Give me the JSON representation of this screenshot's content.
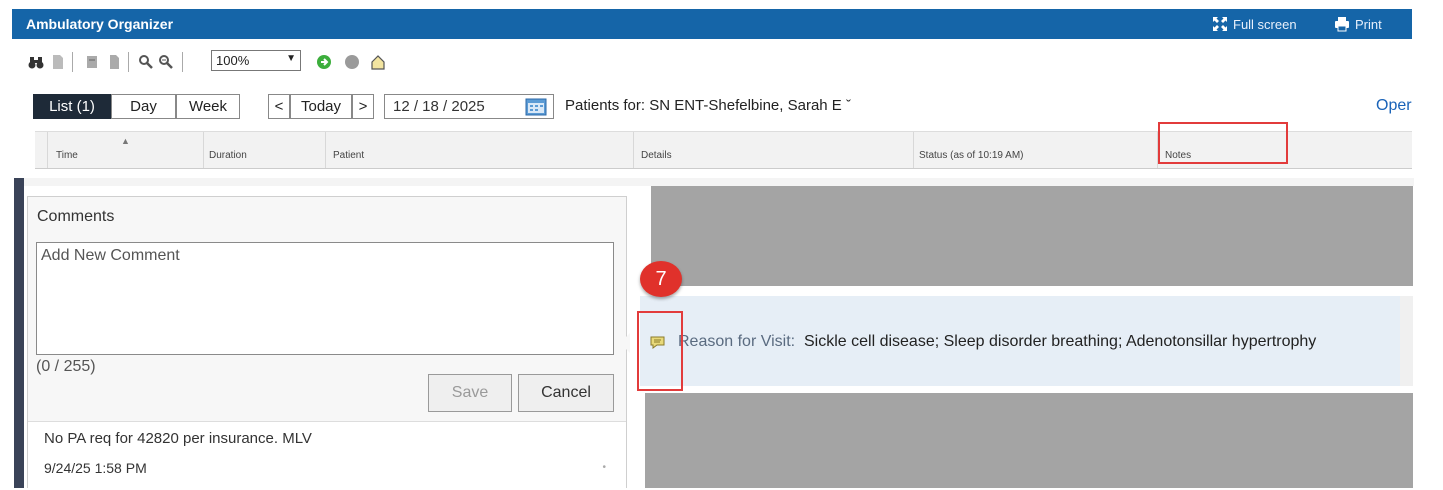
{
  "app": {
    "title": "Ambulatory Organizer",
    "fullscreen_label": "Full screen",
    "print_label": "Print",
    "header_color": "#1565a8"
  },
  "toolbar": {
    "zoom_value": "100%",
    "icons": [
      "binoculars-icon",
      "document-icon",
      "print-preview-icon",
      "copy-icon",
      "zoom-out-icon",
      "zoom-in-icon",
      "refresh-icon",
      "stop-icon",
      "home-icon"
    ]
  },
  "view": {
    "list_label": "List (1)",
    "day_label": "Day",
    "week_label": "Week",
    "prev_label": "<",
    "today_label": "Today",
    "next_label": ">",
    "date_value": "12 / 18 / 2025",
    "patients_for": "Patients for: SN ENT-Shefelbine, Sarah E ˇ",
    "open_label": "Oper"
  },
  "columns": {
    "time": "Time",
    "duration": "Duration",
    "patient": "Patient",
    "details": "Details",
    "status": "Status (as of 10:19 AM)",
    "notes": "Notes"
  },
  "comments": {
    "title": "Comments",
    "placeholder": "Add New Comment",
    "char_count": "(0 / 255)",
    "save_label": "Save",
    "cancel_label": "Cancel",
    "existing_text": "No PA req for 42820 per insurance. MLV",
    "existing_timestamp": "9/24/25 1:58 PM"
  },
  "row": {
    "reason_label": "Reason for Visit:",
    "reason_value": "Sickle cell disease; Sleep disorder breathing; Adenotonsillar hypertrophy"
  },
  "annotation": {
    "step_number": "7",
    "highlight_color": "#e23b3b"
  }
}
